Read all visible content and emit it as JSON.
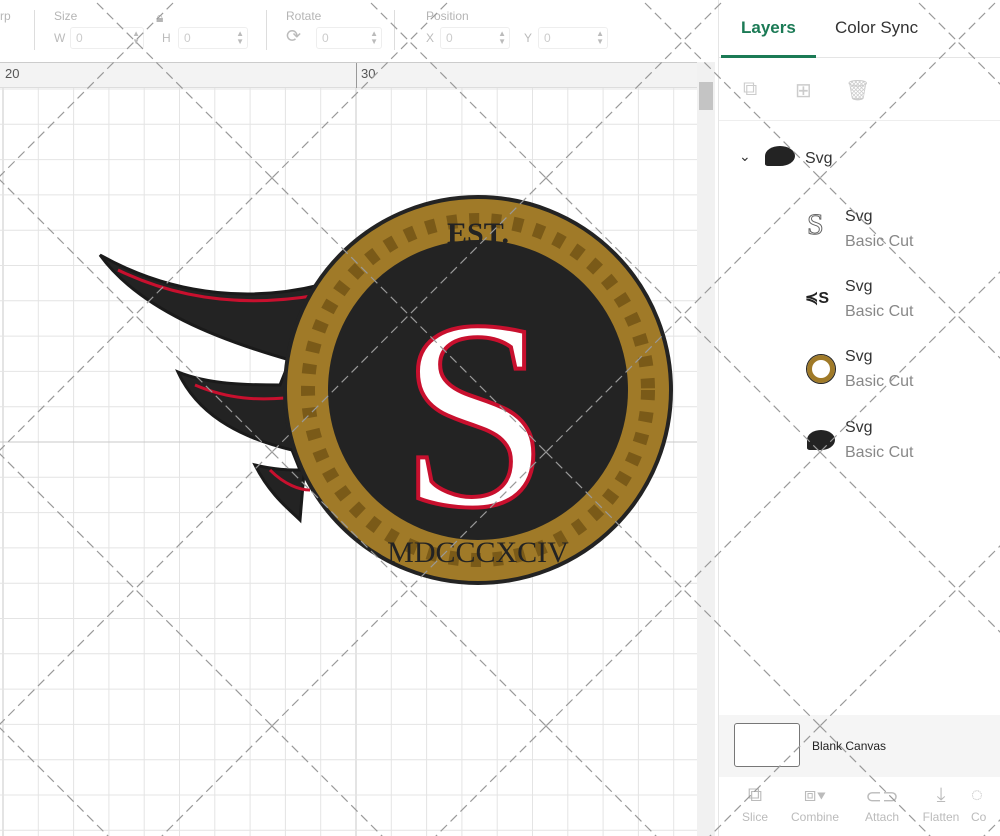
{
  "toolbar": {
    "warp_label": "rp",
    "size_label": "Size",
    "w_label": "W",
    "h_label": "H",
    "w_value": "0",
    "h_value": "0",
    "rotate_label": "Rotate",
    "rotate_value": "0",
    "position_label": "Position",
    "x_label": "X",
    "y_label": "Y",
    "x_value": "0",
    "y_value": "0"
  },
  "ruler": {
    "ticks": [
      "20",
      "30"
    ]
  },
  "logo": {
    "top_text": "EST.",
    "bottom_text": "MDCCCXCIV",
    "letter": "S",
    "colors": {
      "gold": "#a07a28",
      "dark": "#232323",
      "red": "#c8102e",
      "white": "#ffffff"
    }
  },
  "panel": {
    "tabs": [
      {
        "label": "Layers"
      },
      {
        "label": "Color Sync"
      }
    ],
    "group": {
      "name": "Svg"
    },
    "layers": [
      {
        "name": "Svg",
        "type": "Basic Cut"
      },
      {
        "name": "Svg",
        "type": "Basic Cut"
      },
      {
        "name": "Svg",
        "type": "Basic Cut"
      },
      {
        "name": "Svg",
        "type": "Basic Cut"
      }
    ],
    "blank_canvas": "Blank Canvas",
    "actions": [
      {
        "label": "Slice"
      },
      {
        "label": "Combine"
      },
      {
        "label": "Attach"
      },
      {
        "label": "Flatten"
      },
      {
        "label": "Co"
      }
    ]
  }
}
